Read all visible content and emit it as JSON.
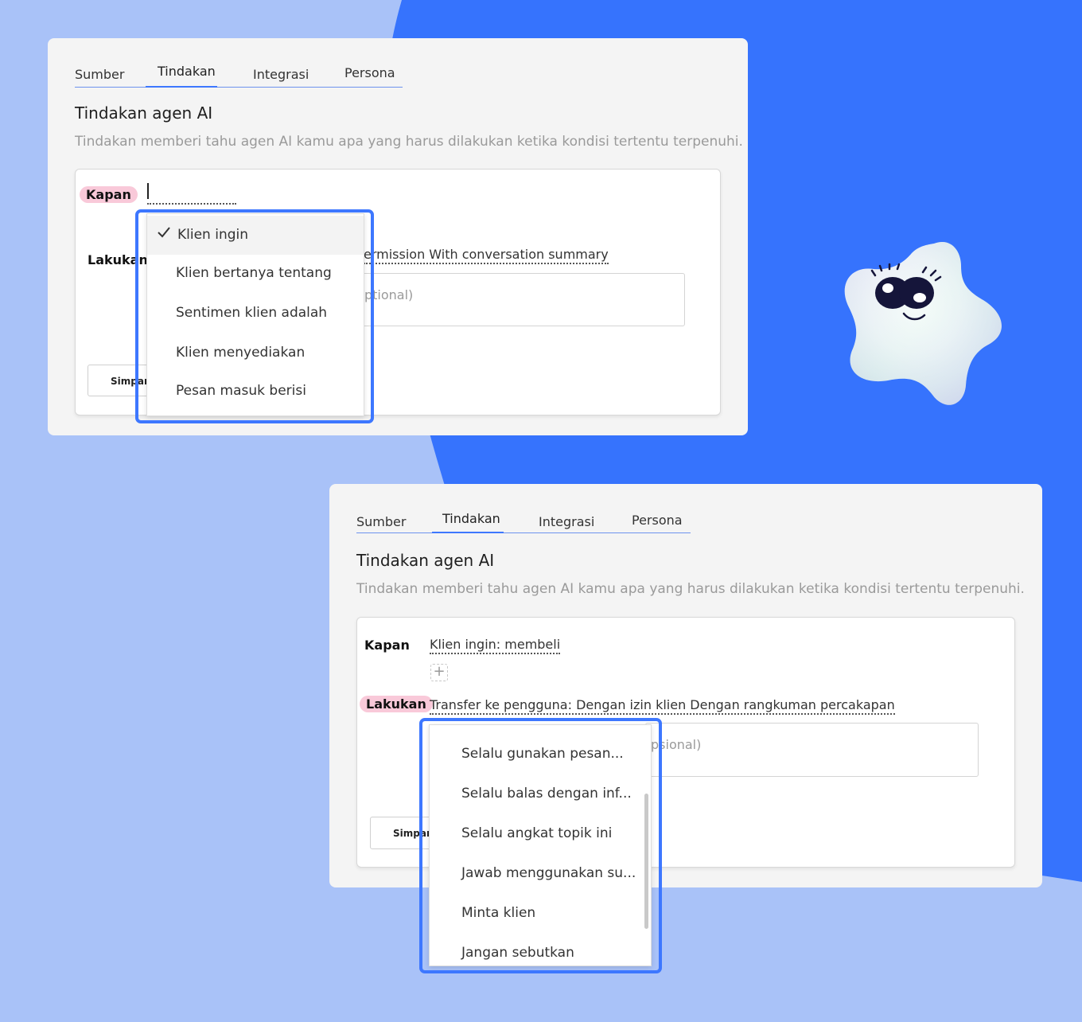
{
  "colors": {
    "background_light": "#a9c2f8",
    "background_blue": "#3673fd",
    "panel": "#f4f4f4",
    "accent": "#3d77ff",
    "pill": "#f9c9d9"
  },
  "top_panel": {
    "tabs": [
      "Sumber",
      "Tindakan",
      "Integrasi",
      "Persona"
    ],
    "active_tab": "Tindakan",
    "heading": "Tindakan agen AI",
    "description": "Tindakan memberi tahu agen AI kamu apa yang harus dilakukan ketika kondisi tertentu terpenuhi.",
    "when_label": "Kapan",
    "do_label": "Lakukan",
    "do_value": "ermission With conversation summary",
    "input_placeholder": "ptional)",
    "save_label": "Simpan",
    "dropdown_items": [
      "Klien ingin",
      "Klien bertanya tentang",
      "Sentimen klien adalah",
      "Klien menyediakan",
      "Pesan masuk berisi"
    ],
    "selected_item": "Klien ingin"
  },
  "bottom_panel": {
    "tabs": [
      "Sumber",
      "Tindakan",
      "Integrasi",
      "Persona"
    ],
    "active_tab": "Tindakan",
    "heading": "Tindakan agen AI",
    "description": "Tindakan memberi tahu agen AI kamu apa yang harus dilakukan ketika kondisi tertentu terpenuhi.",
    "when_label": "Kapan",
    "when_value": "Klien ingin: membeli",
    "add_symbol": "+",
    "do_label": "Lakukan",
    "do_value": "Transfer ke pengguna: Dengan izin klien Dengan rangkuman percakapan",
    "input_placeholder": "psional)",
    "save_label": "Simpan",
    "dropdown_items": [
      "Selalu gunakan pesan...",
      "Selalu balas dengan inf...",
      "Selalu angkat topik ini",
      "Jawab menggunakan su...",
      "Minta klien",
      "Jangan sebutkan"
    ]
  },
  "icons": {
    "check": "check-icon",
    "add": "plus-icon",
    "mascot": "star-mascot"
  }
}
